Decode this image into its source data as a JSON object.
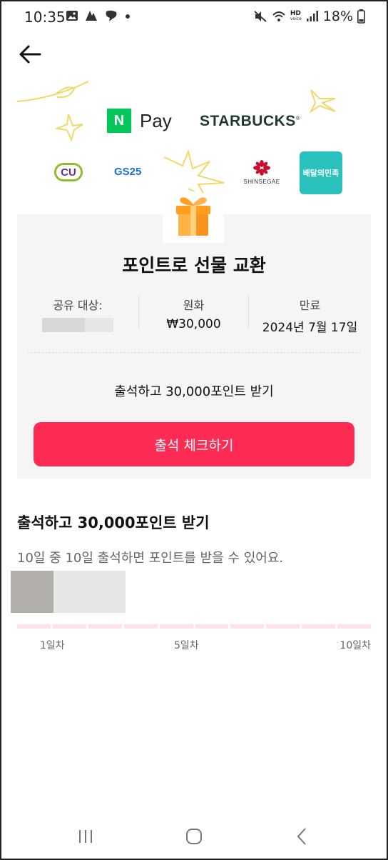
{
  "status_bar": {
    "time": "10:35",
    "battery": "18%",
    "network_badge": "HD",
    "network_sub": "voice",
    "icons": [
      "gallery-icon",
      "app-icon",
      "chat-icon",
      "dot-icon",
      "mute-icon",
      "wifi-icon",
      "signal-icon",
      "battery-icon"
    ]
  },
  "header": {
    "back_icon": "arrow-left-icon"
  },
  "brands": {
    "npay_mark": "N",
    "npay_text": "Pay",
    "starbucks": "STARBUCKS",
    "starbucks_mark": "®",
    "cu": "CU",
    "gs25": "GS25",
    "shinsegae": "SHINSEGAE",
    "baemin": "배달의민족"
  },
  "card": {
    "title": "포인트로 선물 교환",
    "share_label": "공유 대상:",
    "currency_label": "원화",
    "currency_value": "₩30,000",
    "expiry_label": "만료",
    "expiry_value": "2024년 7월 17일",
    "subtitle": "출석하고 30,000포인트 받기",
    "cta": "출석 체크하기"
  },
  "attendance": {
    "title": "출석하고 30,000포인트 받기",
    "description": "10일 중 10일 출석하면 포인트를 받을 수 있어요.",
    "total_days": 10,
    "completed_days": 0,
    "day_labels": [
      "1일차",
      "5일차",
      "10일차"
    ]
  },
  "colors": {
    "accent": "#fe2c55",
    "track": "#ffe2e8",
    "card_bg": "#f5f5f5",
    "npay_green": "#03c75a",
    "starbucks_green": "#1e3932",
    "baemin_teal": "#2ac1bc"
  },
  "nav": {
    "icons": [
      "recent-apps-icon",
      "home-icon",
      "back-nav-icon"
    ]
  }
}
